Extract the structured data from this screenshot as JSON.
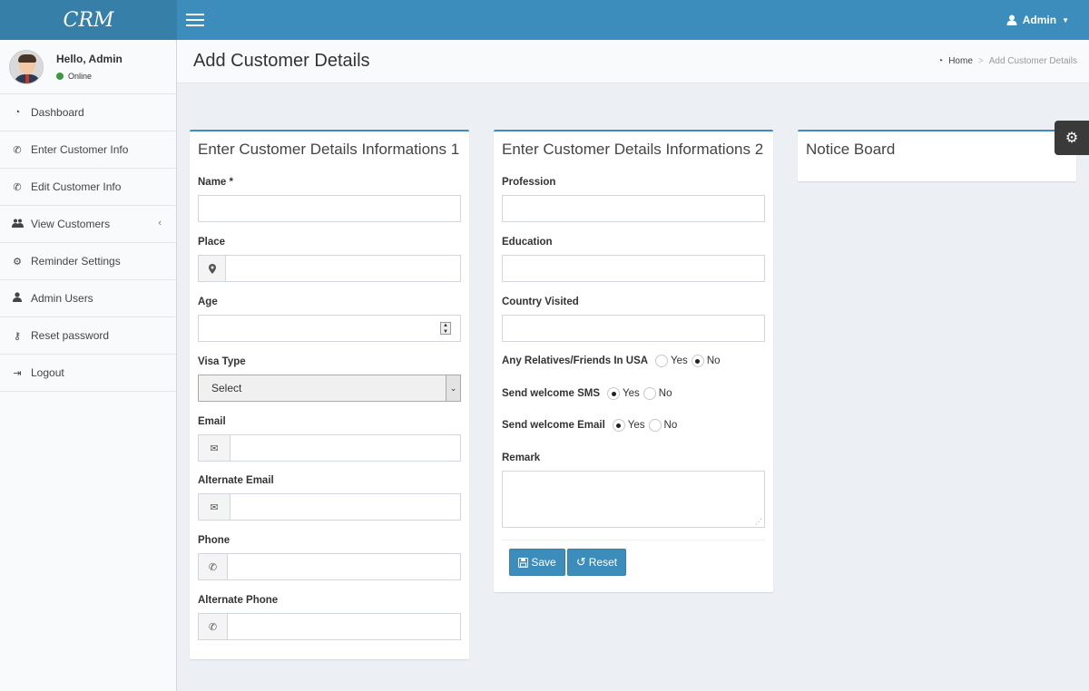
{
  "brand": {
    "logo": "CRM"
  },
  "header": {
    "user_label": "Admin"
  },
  "sidebar": {
    "greeting": "Hello, Admin",
    "status": "Online",
    "items": [
      {
        "label": "Dashboard",
        "icon": "dashboard-icon"
      },
      {
        "label": "Enter Customer Info",
        "icon": "phone-icon"
      },
      {
        "label": "Edit Customer Info",
        "icon": "phone-icon"
      },
      {
        "label": "View Customers",
        "icon": "users-icon"
      },
      {
        "label": "Reminder Settings",
        "icon": "gear-icon"
      },
      {
        "label": "Admin Users",
        "icon": "user-icon"
      },
      {
        "label": "Reset password",
        "icon": "key-icon"
      },
      {
        "label": "Logout",
        "icon": "logout-icon"
      }
    ]
  },
  "content_header": {
    "title": "Add Customer Details",
    "breadcrumb": {
      "home": "Home",
      "current": "Add Customer Details"
    }
  },
  "form1": {
    "title": "Enter Customer Details Informations 1",
    "name_label": "Name *",
    "place_label": "Place",
    "age_label": "Age",
    "visa_label": "Visa Type",
    "visa_selected": "Select",
    "email_label": "Email",
    "alt_email_label": "Alternate Email",
    "phone_label": "Phone",
    "alt_phone_label": "Alternate Phone"
  },
  "form2": {
    "title": "Enter Customer Details Informations 2",
    "profession_label": "Profession",
    "education_label": "Education",
    "country_label": "Country Visited",
    "relatives": {
      "label": "Any Relatives/Friends In USA",
      "yes": "Yes",
      "no": "No",
      "selected": "No"
    },
    "sms": {
      "label": "Send welcome SMS",
      "yes": "Yes",
      "no": "No",
      "selected": "Yes"
    },
    "email": {
      "label": "Send welcome Email",
      "yes": "Yes",
      "no": "No",
      "selected": "Yes"
    },
    "remark_label": "Remark",
    "save_label": "Save",
    "reset_label": "Reset"
  },
  "notice": {
    "title": "Notice Board"
  },
  "colors": {
    "primary": "#3c8dbc",
    "logo_bg": "#367fa9",
    "online": "#3c9a3c"
  }
}
